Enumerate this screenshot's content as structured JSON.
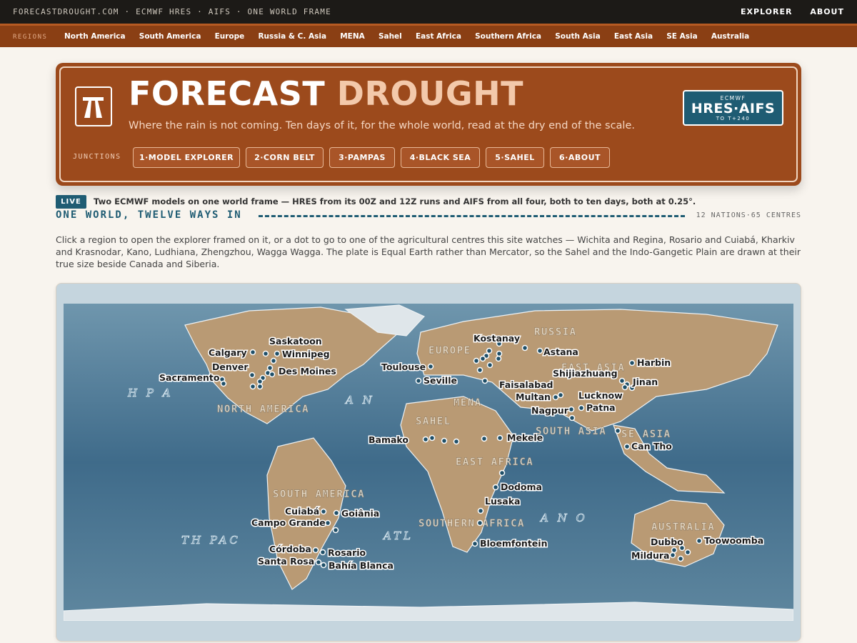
{
  "topbar": {
    "site": "FORECASTDROUGHT.COM · ECMWF HRES · AIFS · ONE WORLD FRAME",
    "explorer": "EXPLORER",
    "about": "ABOUT"
  },
  "regions": {
    "label": "REGIONS",
    "items": [
      "North America",
      "South America",
      "Europe",
      "Russia & C. Asia",
      "MENA",
      "Sahel",
      "East Africa",
      "Southern Africa",
      "South Asia",
      "East Asia",
      "SE Asia",
      "Australia"
    ]
  },
  "hero": {
    "title_a": "FORECAST",
    "title_b": "DROUGHT",
    "subtitle": "Where the rain is not coming. Ten days of it, for the whole world, read at the dry end of the scale.",
    "badge_top": "ECMWF",
    "badge_main": "HRES·AIFS",
    "badge_bottom": "TO T+240",
    "junctions_label": "JUNCTIONS",
    "junctions": [
      "1·MODEL EXPLORER",
      "2·CORN BELT",
      "3·PAMPAS",
      "4·BLACK SEA",
      "5·SAHEL",
      "6·ABOUT"
    ],
    "colors": {
      "hero_bg": "#9c4a1c",
      "badge_bg": "#1f5c73"
    }
  },
  "live": {
    "badge": "LIVE",
    "text": "Two ECMWF models on one world frame — HRES from its 00Z and 12Z runs and AIFS from all four, both to ten days, both at 0.25°."
  },
  "section": {
    "title": "ONE WORLD, TWELVE WAYS IN",
    "counts": "12 NATIONS·65 CENTRES",
    "intro": "Click a region to open the explorer framed on it, or a dot to go to one of the agricultural centres this site watches — Wichita and Regina, Rosario and Cuiabá, Kharkiv and Krasnodar, Kano, Ludhiana, Zhengzhou, Wagga Wagga. The plate is Equal Earth rather than Mercator, so the Sahel and the Indo-Gangetic Plain are drawn at their true size beside Canada and Siberia."
  },
  "map": {
    "region_labels": [
      "NORTH AMERICA",
      "SOUTH AMERICA",
      "EUROPE",
      "RUSSIA",
      "MENA",
      "SAHEL",
      "EAST AFRICA",
      "SOUTHERN AFRICA",
      "SOUTH ASIA",
      "EAST ASIA",
      "SE ASIA",
      "AUSTRALIA"
    ],
    "ocean_labels": [
      "H P A",
      "A N",
      "TH PAC",
      "ATL",
      "A N O"
    ],
    "cities": [
      "Saskatoon",
      "Calgary",
      "Winnipeg",
      "Denver",
      "Des Moines",
      "Sacramento",
      "Kostanay",
      "Astana",
      "Toulouse",
      "Seville",
      "Faisalabad",
      "Shijiazhuang",
      "Harbin",
      "Jinan",
      "Multan",
      "Lucknow",
      "Nagpur",
      "Patna",
      "Bamako",
      "Mekele",
      "Can Tho",
      "Dodoma",
      "Lusaka",
      "Bloemfontein",
      "Cuiabá",
      "Goiânia",
      "Campo Grande",
      "Córdoba",
      "Rosario",
      "Santa Rosa",
      "Bahía Blanca",
      "Dubbo",
      "Toowoomba",
      "Mildura"
    ]
  }
}
